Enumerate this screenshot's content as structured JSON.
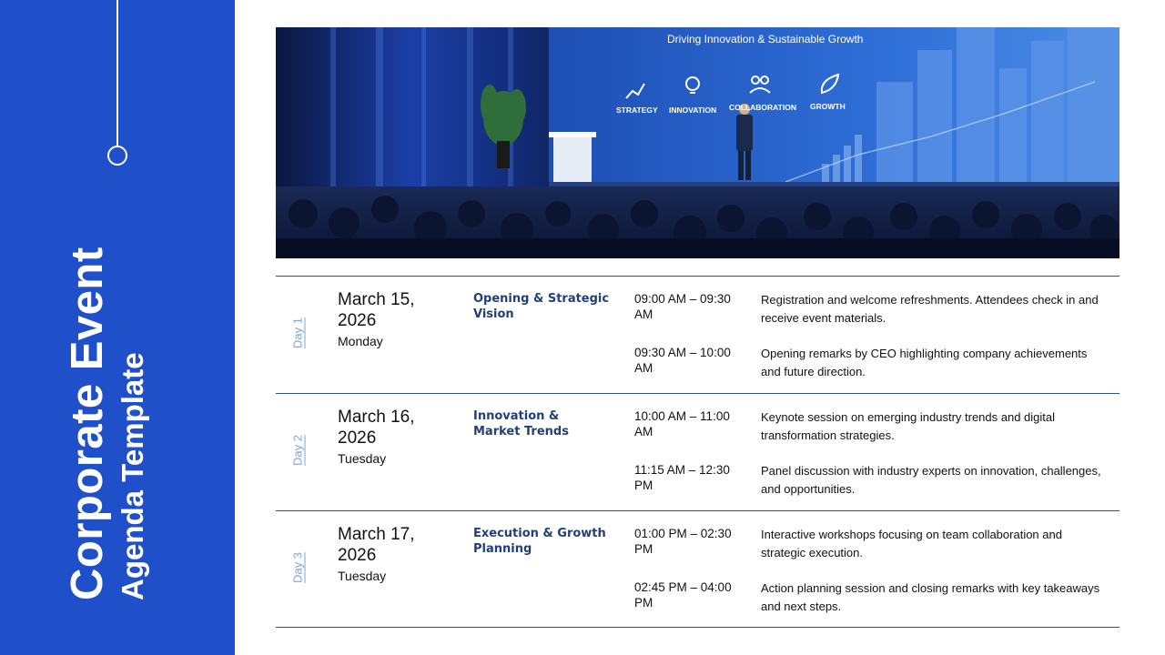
{
  "sidebar": {
    "title_line1": "Corporate Event",
    "title_line2": "Agenda Template"
  },
  "hero": {
    "screen_tagline": "Driving Innovation & Sustainable Growth",
    "screen_icons": [
      {
        "icon": "chart-icon",
        "label": "STRATEGY"
      },
      {
        "icon": "lightbulb-icon",
        "label": "INNOVATION"
      },
      {
        "icon": "people-icon",
        "label": "COLLABORATION"
      },
      {
        "icon": "leaf-icon",
        "label": "GROWTH"
      }
    ]
  },
  "agenda": [
    {
      "day_label": "Day 1",
      "date": "March 15, 2026",
      "weekday": "Monday",
      "topic": "Opening & Strategic Vision",
      "sessions": [
        {
          "time": "09:00 AM – 09:30 AM",
          "description": "Registration and welcome refreshments. Attendees check in and receive event materials."
        },
        {
          "time": "09:30 AM – 10:00 AM",
          "description": "Opening remarks by CEO highlighting company achievements and future direction."
        }
      ]
    },
    {
      "day_label": "Day 2",
      "date": "March 16, 2026",
      "weekday": "Tuesday",
      "topic": "Innovation & Market Trends",
      "sessions": [
        {
          "time": "10:00 AM – 11:00 AM",
          "description": "Keynote session on emerging industry trends and digital transformation strategies."
        },
        {
          "time": "11:15 AM – 12:30 PM",
          "description": "Panel discussion with industry experts on innovation, challenges, and opportunities."
        }
      ]
    },
    {
      "day_label": "Day 3",
      "date": "March 17, 2026",
      "weekday": "Tuesday",
      "topic": "Execution & Growth Planning",
      "sessions": [
        {
          "time": "01:00 PM – 02:30 PM",
          "description": "Interactive workshops focusing on team collaboration and strategic execution."
        },
        {
          "time": "02:45 PM – 04:00 PM",
          "description": "Action planning session and closing remarks with key takeaways and next steps."
        }
      ]
    }
  ],
  "colors": {
    "sidebar_blue": "#1f4fc9",
    "topic_navy": "#213f7a",
    "day_label": "#7aa6da",
    "rule": "#2b4f8f"
  }
}
